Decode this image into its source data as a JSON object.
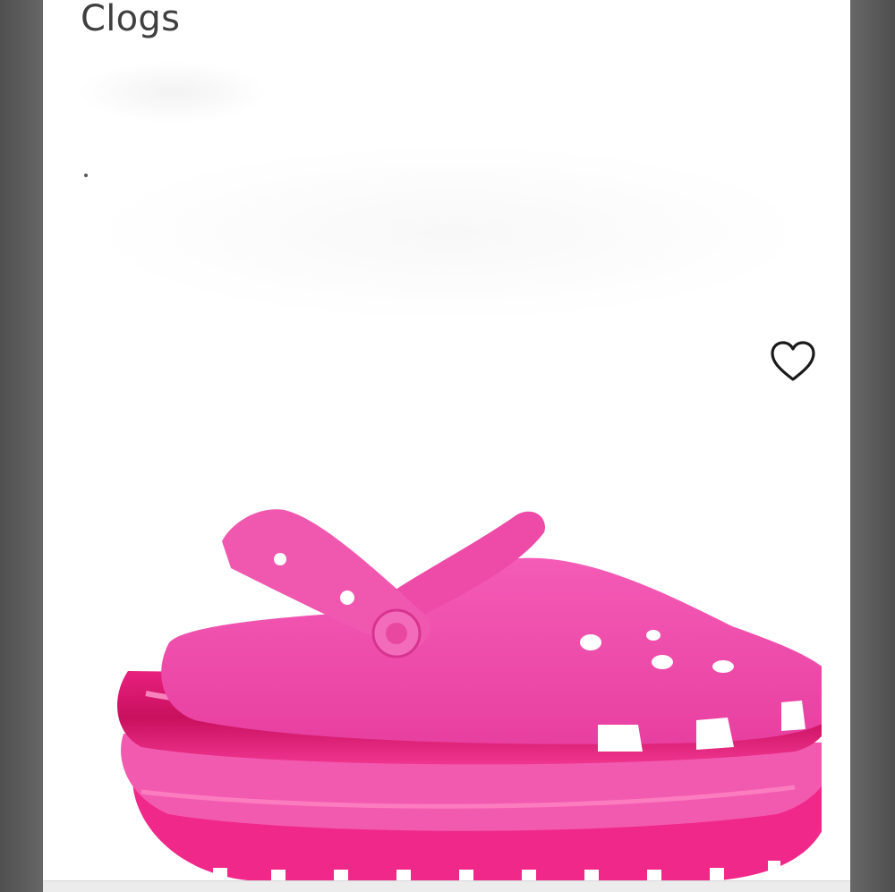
{
  "product": {
    "title": "Clogs",
    "image_icon": "pink-platform-clog-image",
    "favorite_icon": "heart-outline-icon"
  },
  "colors": {
    "shoe_pink": "#f040a8",
    "sole_magenta": "#e0157a",
    "background": "#ffffff"
  }
}
